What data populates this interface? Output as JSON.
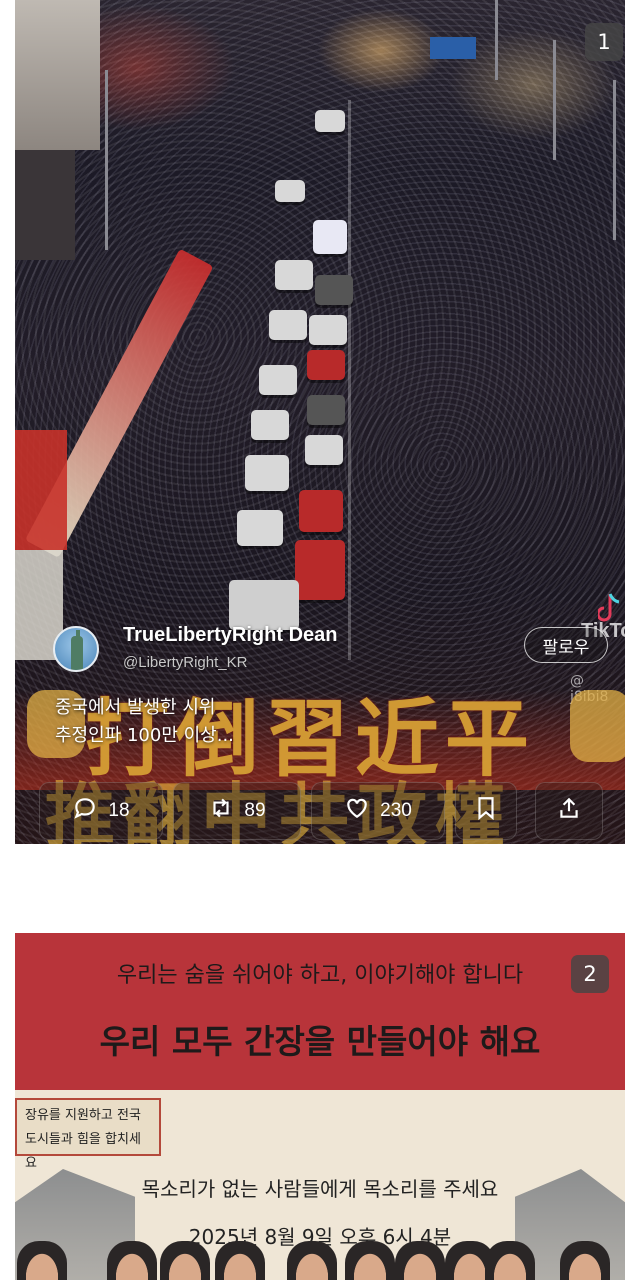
{
  "post1": {
    "page_number": "1",
    "author_name": "TrueLibertyRight Dean",
    "author_handle": "@LibertyRight_KR",
    "follow_label": "팔로우",
    "watermark_brand": "TikTo",
    "watermark_handle": "@ j8ibi8",
    "banner_line1": "打倒習近平",
    "banner_line2": "推翻中共政權",
    "caption_line1": "중국에서 발생한 시위",
    "caption_line2": "추정인파 100만 이상...",
    "actions": {
      "reply_count": "18",
      "repost_count": "89",
      "like_count": "230"
    },
    "icons": [
      "reply-icon",
      "repost-icon",
      "like-icon",
      "bookmark-icon",
      "share-icon"
    ]
  },
  "post2": {
    "page_number": "2",
    "subtitle": "우리는 숨을 쉬어야 하고, 이야기해야 합니다",
    "headline": "우리 모두 간장을 만들어야 해요",
    "box_line1": "장유를 지원하고 전국",
    "box_line2": "도시들과 힘을 합치세요",
    "voice_text": "목소리가 없는 사람들에게 목소리를 주세요",
    "date_text": "2025년 8월 9일 오후 6시 4분"
  },
  "colors": {
    "poster_red": "#b8343a",
    "poster_cream": "#efe6d6",
    "banner_gold": "#e5be3c",
    "badge_bg": "#464646"
  }
}
